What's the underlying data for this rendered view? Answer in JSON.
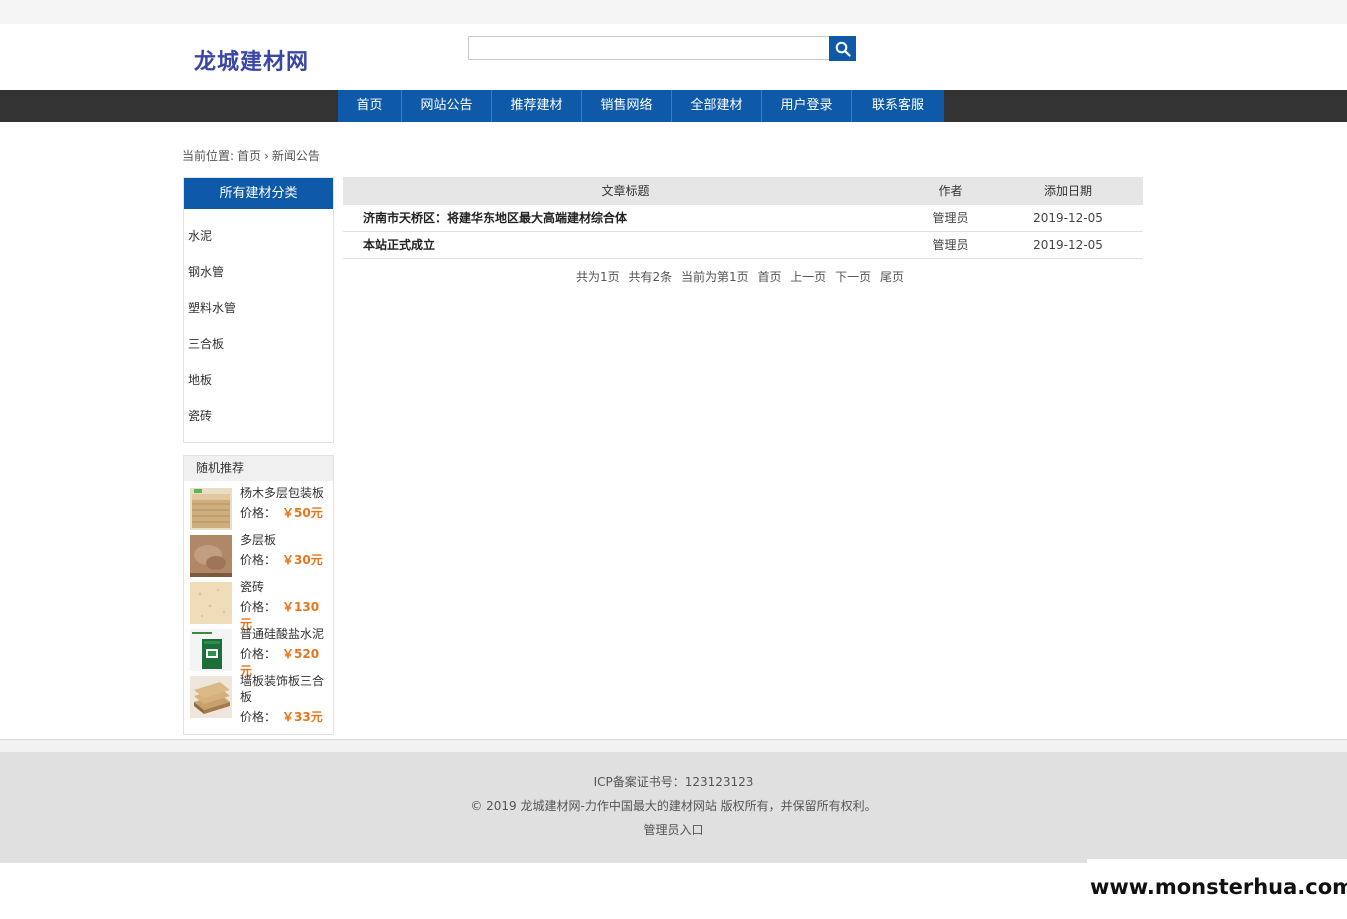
{
  "site": {
    "logo": "龙城建材网"
  },
  "search": {
    "placeholder": "",
    "button_icon": "search-icon"
  },
  "nav": {
    "items": [
      {
        "label": "首页"
      },
      {
        "label": "网站公告"
      },
      {
        "label": "推荐建材"
      },
      {
        "label": "销售网络"
      },
      {
        "label": "全部建材"
      },
      {
        "label": "用户登录"
      },
      {
        "label": "联系客服"
      }
    ]
  },
  "breadcrumb": {
    "prefix": "当前位置:",
    "home": "首页",
    "separator": "›",
    "current": "新闻公告"
  },
  "categories": {
    "title": "所有建材分类",
    "items": [
      {
        "label": "水泥"
      },
      {
        "label": "钢水管"
      },
      {
        "label": "塑料水管"
      },
      {
        "label": "三合板"
      },
      {
        "label": "地板"
      },
      {
        "label": "瓷砖"
      }
    ]
  },
  "recommend": {
    "title": "随机推荐",
    "price_label": "价格：",
    "items": [
      {
        "name": "杨木多层包装板",
        "price": "￥50元",
        "thumb": "plywood-stack"
      },
      {
        "name": "多层板",
        "price": "￥30元",
        "thumb": "wood-panel"
      },
      {
        "name": "瓷砖",
        "price": "￥130元",
        "thumb": "tile"
      },
      {
        "name": "普通硅酸盐水泥",
        "price": "￥520元",
        "thumb": "cement-bag"
      },
      {
        "name": "墙板装饰板三合板",
        "price": "￥33元",
        "thumb": "plywood-boards"
      }
    ]
  },
  "table": {
    "headers": {
      "title": "文章标题",
      "author": "作者",
      "date": "添加日期"
    },
    "rows": [
      {
        "title": "济南市天桥区：将建华东地区最大高端建材综合体",
        "author": "管理员",
        "date": "2019-12-05"
      },
      {
        "title": "本站正式成立",
        "author": "管理员",
        "date": "2019-12-05"
      }
    ]
  },
  "pager": {
    "total_pages": "共为1页",
    "total_items": "共有2条",
    "current": "当前为第1页",
    "first": "首页",
    "prev": "上一页",
    "next": "下一页",
    "last": "尾页"
  },
  "footer": {
    "icp": "ICP备案证书号：123123123",
    "copyright": "© 2019 龙城建材网-力作中国最大的建材网站 版权所有，并保留所有权利。",
    "admin": "管理员入口"
  },
  "watermark": "www.monsterhua.com",
  "colors": {
    "brand_blue": "#0f5aa8",
    "nav_dark": "#333333",
    "price_orange": "#e8741c",
    "logo": "#3a47a8"
  }
}
